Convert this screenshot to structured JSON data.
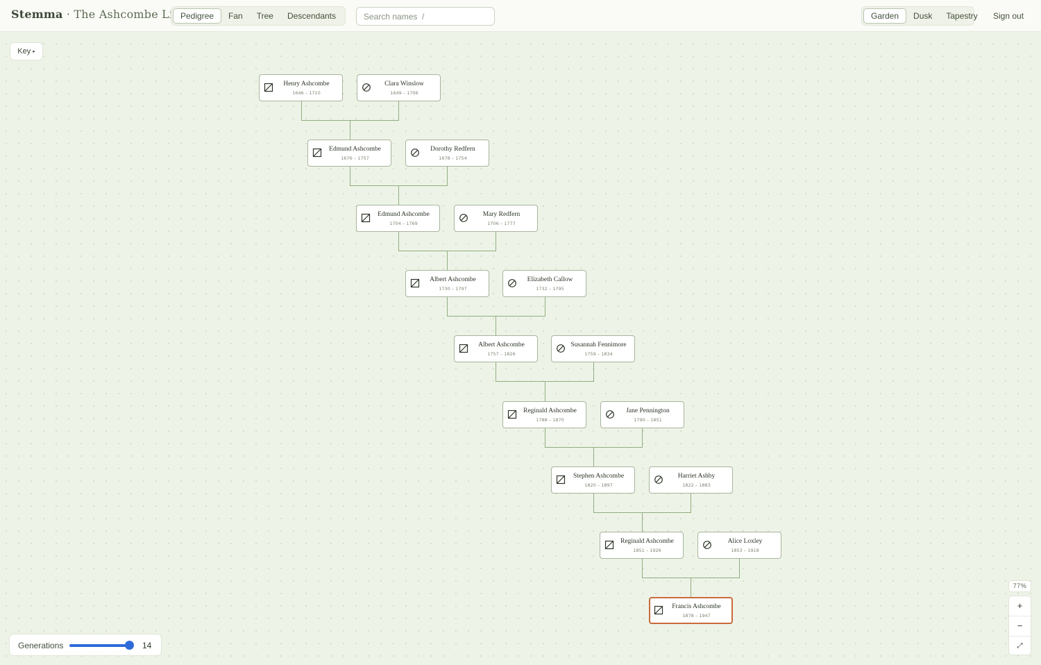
{
  "header": {
    "brand_name": "Stemma",
    "brand_separator": " · ",
    "tree_title": "The Ashcombe Line",
    "views": [
      "Pedigree",
      "Fan",
      "Tree",
      "Descendants"
    ],
    "active_view": "Pedigree",
    "search_placeholder": "Search names  /",
    "themes": [
      "Garden",
      "Dusk",
      "Tapestry"
    ],
    "active_theme": "Garden",
    "sign_out": "Sign out"
  },
  "key_button": {
    "label": "Key",
    "caret": "▸"
  },
  "people": [
    {
      "name": "Henry Ashcombe",
      "years": "1646 – 1710",
      "sex": "male"
    },
    {
      "name": "Clara Winslow",
      "years": "1649 – 1706",
      "sex": "female"
    },
    {
      "name": "Edmund Ashcombe",
      "years": "1676 – 1757",
      "sex": "male"
    },
    {
      "name": "Dorothy Redfern",
      "years": "1678 – 1754",
      "sex": "female"
    },
    {
      "name": "Edmund Ashcombe",
      "years": "1704 – 1769",
      "sex": "male"
    },
    {
      "name": "Mary Redfern",
      "years": "1706 – 1777",
      "sex": "female"
    },
    {
      "name": "Albert Ashcombe",
      "years": "1730 – 1797",
      "sex": "male"
    },
    {
      "name": "Elizabeth Callow",
      "years": "1732 – 1795",
      "sex": "female"
    },
    {
      "name": "Albert Ashcombe",
      "years": "1757 – 1826",
      "sex": "male"
    },
    {
      "name": "Susannah Fennimore",
      "years": "1759 – 1834",
      "sex": "female"
    },
    {
      "name": "Reginald Ashcombe",
      "years": "1788 – 1870",
      "sex": "male"
    },
    {
      "name": "Jane Pennington",
      "years": "1790 – 1851",
      "sex": "female"
    },
    {
      "name": "Stephen Ashcombe",
      "years": "1820 – 1897",
      "sex": "male"
    },
    {
      "name": "Harriet Ashby",
      "years": "1822 – 1883",
      "sex": "female"
    },
    {
      "name": "Reginald Ashcombe",
      "years": "1851 – 1926",
      "sex": "male"
    },
    {
      "name": "Alice Loxley",
      "years": "1853 – 1918",
      "sex": "female"
    },
    {
      "name": "Francis Ashcombe",
      "years": "1878 – 1947",
      "sex": "male",
      "focused": true
    }
  ],
  "zoom": {
    "level": "77%",
    "in": "+",
    "out": "−",
    "fit": "⤢"
  },
  "generations": {
    "label": "Generations",
    "value": "14",
    "fraction": 0.93
  },
  "colors": {
    "accent": "#2f6bd8",
    "focus": "#c86b3c",
    "connector": "#8fae7f",
    "card_border": "#a7b59c"
  }
}
